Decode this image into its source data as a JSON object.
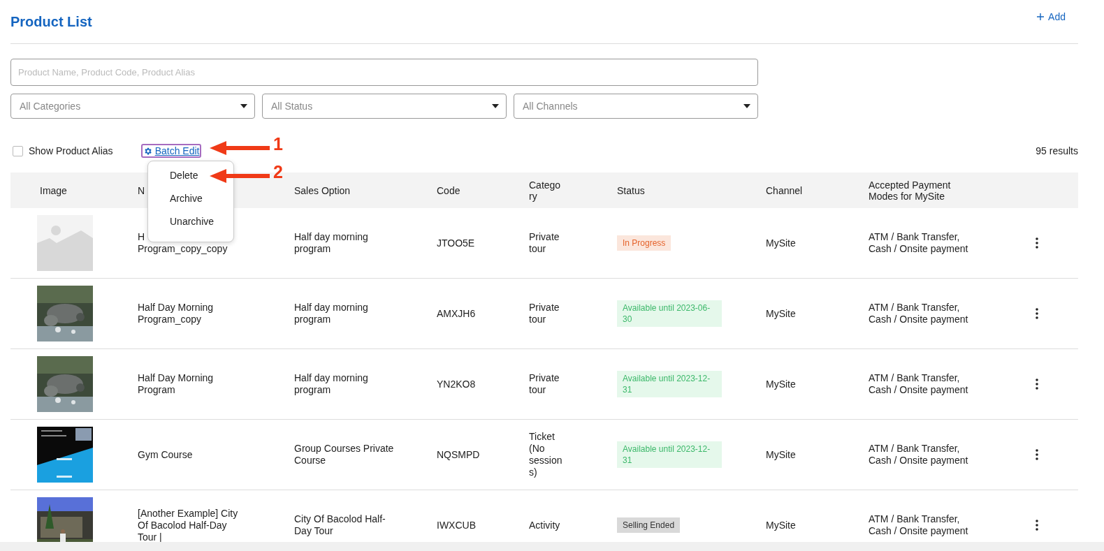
{
  "header": {
    "title": "Product List",
    "add_label": "Add"
  },
  "search": {
    "placeholder": "Product Name, Product Code, Product Alias"
  },
  "filters": [
    {
      "value": "All Categories"
    },
    {
      "value": "All Status"
    },
    {
      "value": "All Channels"
    }
  ],
  "toolbar": {
    "show_alias": {
      "label": "Show Product Alias",
      "checked": false
    },
    "batch_edit": {
      "label": "Batch Edit",
      "expanded": true
    },
    "results": "95 results"
  },
  "batch_menu": [
    "Delete",
    "Archive",
    "Unarchive"
  ],
  "annotations": [
    {
      "label": "1"
    },
    {
      "label": "2"
    }
  ],
  "table": {
    "columns": [
      "Image",
      "N",
      "Sales Option",
      "Code",
      "Catego ry",
      "Status",
      "Channel",
      "Accepted Payment Modes for MySite"
    ],
    "rows": [
      {
        "image": {
          "kind": "placeholder"
        },
        "name": "H\nProgram_copy_copy",
        "sales_option": "Half day morning program",
        "code": "JTOO5E",
        "category": "Private tour",
        "status": {
          "text": "In Progress",
          "kind": "in_progress"
        },
        "channel": "MySite",
        "payment": "ATM / Bank Transfer, Cash / Onsite payment"
      },
      {
        "image": {
          "kind": "elephants"
        },
        "name": "Half Day Morning Program_copy",
        "sales_option": "Half day morning program",
        "code": "AMXJH6",
        "category": "Private tour",
        "status": {
          "text": "Available until 2023-06-30",
          "kind": "available"
        },
        "channel": "MySite",
        "payment": "ATM / Bank Transfer, Cash / Onsite payment"
      },
      {
        "image": {
          "kind": "elephants"
        },
        "name": "Half Day Morning Program",
        "sales_option": "Half day morning program",
        "code": "YN2KO8",
        "category": "Private tour",
        "status": {
          "text": "Available until 2023-12-31",
          "kind": "available"
        },
        "channel": "MySite",
        "payment": "ATM / Bank Transfer, Cash / Onsite payment"
      },
      {
        "image": {
          "kind": "poster"
        },
        "name": "Gym Course",
        "sales_option": "Group Courses Private Course",
        "code": "NQSMPD",
        "category": "Ticket (No session s)",
        "status": {
          "text": "Available until 2023-12-31",
          "kind": "available"
        },
        "channel": "MySite",
        "payment": "ATM / Bank Transfer, Cash / Onsite payment"
      },
      {
        "image": {
          "kind": "building"
        },
        "name": "[Another Example] City Of Bacolod Half-Day Tour |",
        "sales_option": "City Of Bacolod Half-Day Tour",
        "code": "IWXCUB",
        "category": "Activity",
        "status": {
          "text": "Selling Ended",
          "kind": "ended"
        },
        "channel": "MySite",
        "payment": "ATM / Bank Transfer, Cash / Onsite payment"
      }
    ]
  }
}
